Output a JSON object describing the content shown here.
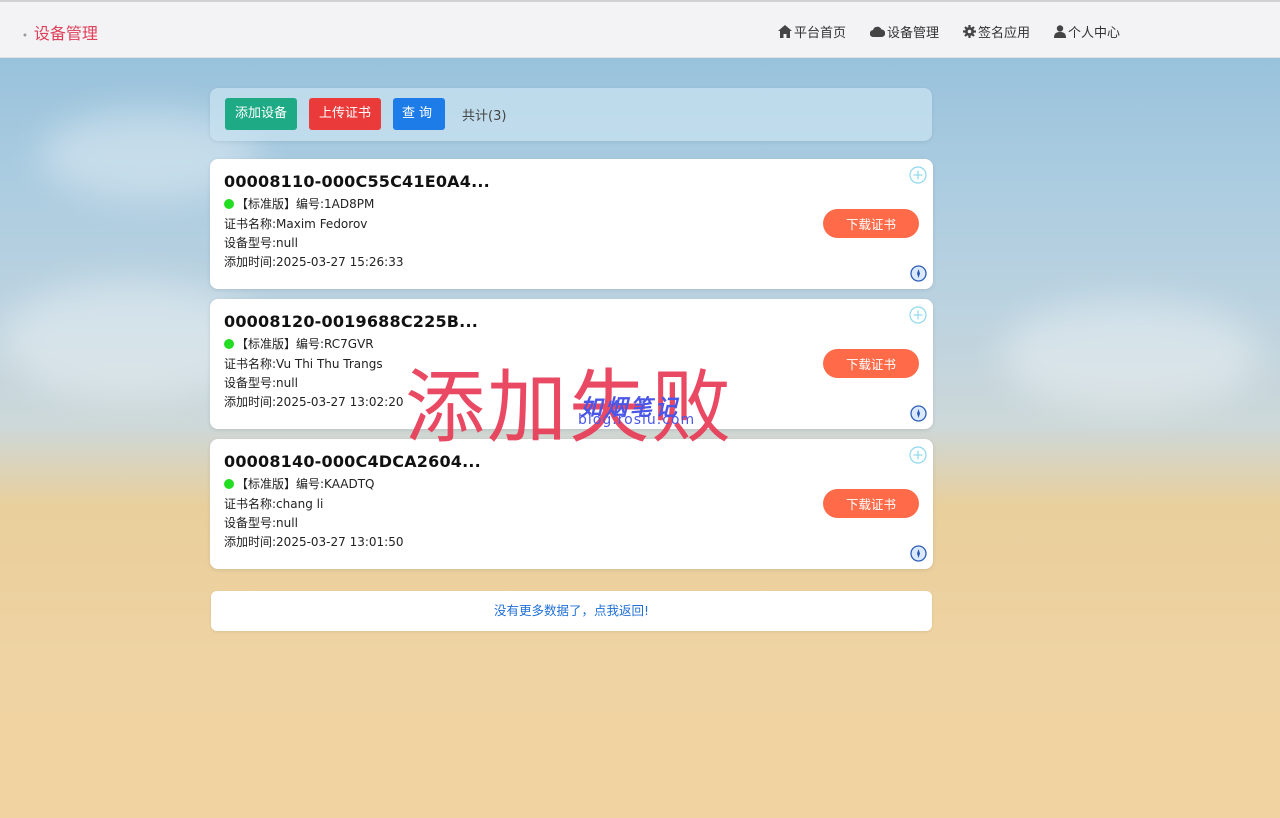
{
  "header": {
    "brand": "设备管理",
    "nav": [
      {
        "label": "平台首页",
        "icon": "home-icon"
      },
      {
        "label": "设备管理",
        "icon": "cloud-icon"
      },
      {
        "label": "签名应用",
        "icon": "gear-icon"
      },
      {
        "label": "个人中心",
        "icon": "user-icon"
      }
    ]
  },
  "toolbar": {
    "add_label": "添加设备",
    "upload_label": "上传证书",
    "query_label": "查询",
    "total": "共计(3)"
  },
  "devices": [
    {
      "title": "00008110-000C55C41E0A4...",
      "edition": "【标准版】编号:1AD8PM",
      "cert_name": "证书名称:Maxim Fedorov",
      "model": "设备型号:null",
      "added": "添加时间:2025-03-27 15:26:33",
      "download_label": "下载证书"
    },
    {
      "title": "00008120-0019688C225B...",
      "edition": "【标准版】编号:RC7GVR",
      "cert_name": "证书名称:Vu Thi Thu Trangs",
      "model": "设备型号:null",
      "added": "添加时间:2025-03-27 13:02:20",
      "download_label": "下载证书"
    },
    {
      "title": "00008140-000C4DCA2604...",
      "edition": "【标准版】编号:KAADTQ",
      "cert_name": "证书名称:chang li",
      "model": "设备型号:null",
      "added": "添加时间:2025-03-27 13:01:50",
      "download_label": "下载证书"
    }
  ],
  "footer": {
    "more_text": "没有更多数据了，点我返回!"
  },
  "overlay": {
    "text": "添加失败"
  },
  "watermark": {
    "text": "如烟笔记",
    "sub": "blog.rosiu.com"
  },
  "colors": {
    "brand": "#e0405a",
    "add": "#1eaa84",
    "upload": "#ea3a3a",
    "query": "#1e7ce8",
    "download": "#ff6a48",
    "status": "#22dd22"
  }
}
